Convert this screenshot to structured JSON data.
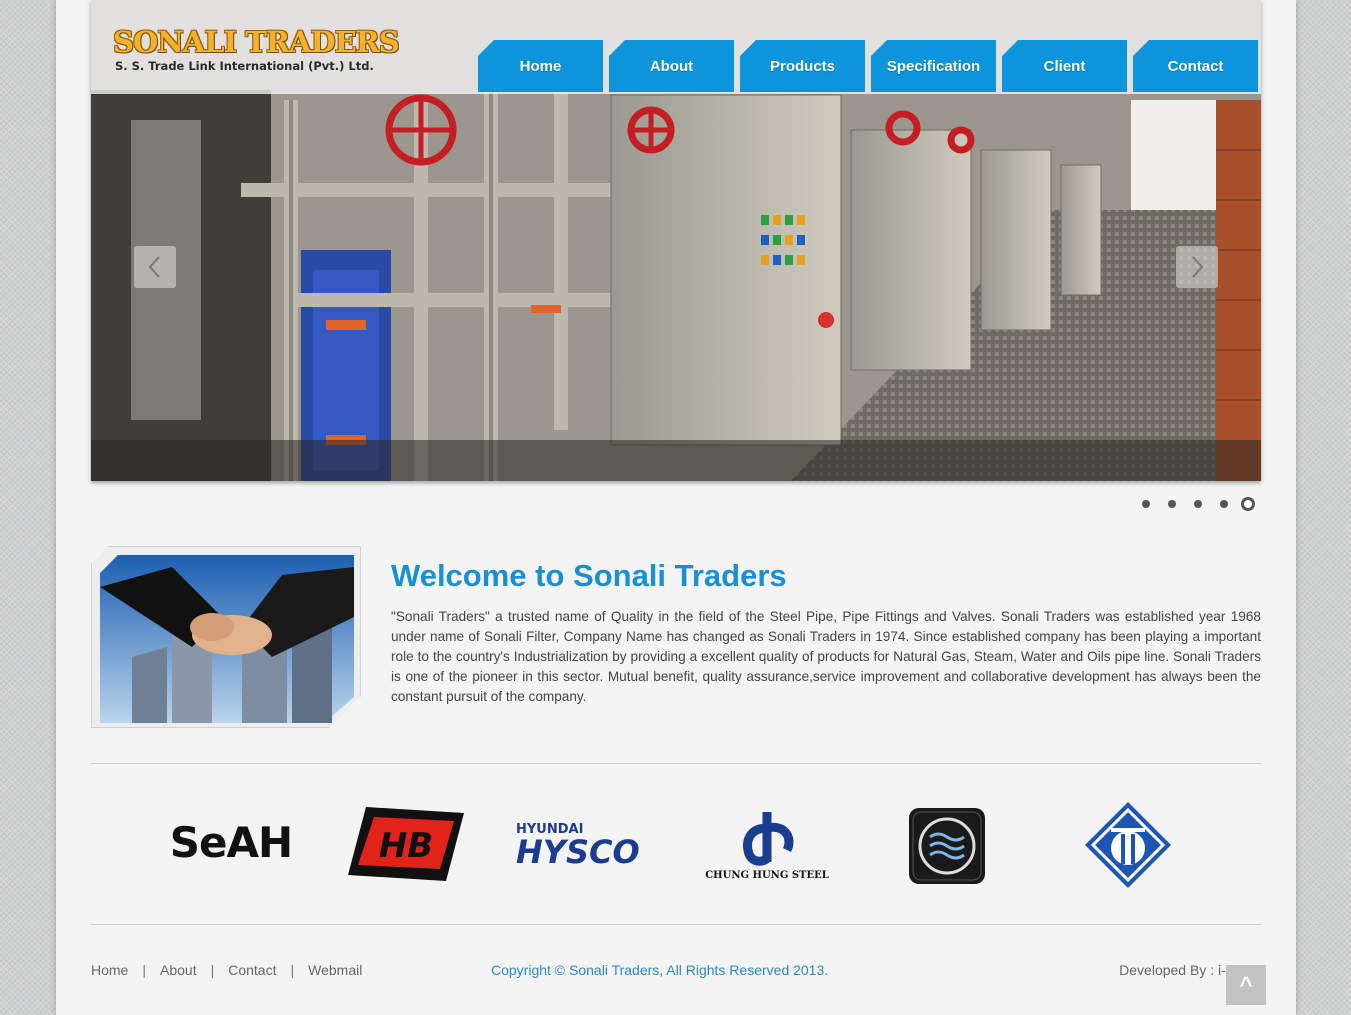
{
  "logo": {
    "title": "SONALI TRADERS",
    "subtitle": "S. S. Trade Link International (Pvt.) Ltd."
  },
  "nav": {
    "items": [
      {
        "label": "Home"
      },
      {
        "label": "About"
      },
      {
        "label": "Products"
      },
      {
        "label": "Specification"
      },
      {
        "label": "Client"
      },
      {
        "label": "Contact"
      }
    ]
  },
  "slider": {
    "slide_count": 5,
    "active_index": 4,
    "prev_icon": "chevron-left-icon",
    "next_icon": "chevron-right-icon"
  },
  "welcome": {
    "title": "Welcome to Sonali Traders",
    "text": "\"Sonali Traders\" a trusted name of Quality in the field of the Steel Pipe, Pipe Fittings and Valves. Sonali Traders was established year 1968 under name of Sonali Filter, Company Name has changed as Sonali Traders in 1974. Since established company has been playing a important role to the country's Industrialization by providing a excellent quality of products for Natural Gas, Steam, Water and Oils pipe line. Sonali Traders is one of the pioneer in this sector. Mutual benefit, quality assurance,service improvement and collaborative development has always been the constant pursuit of the company."
  },
  "clients": {
    "seah": "SeAH",
    "hb": "HB",
    "hysco_top": "HYUNDAI",
    "hysco_main": "HYSCO",
    "chung_hung": "CHUNG HUNG STEEL"
  },
  "footer": {
    "links": [
      "Home",
      "About",
      "Contact",
      "Webmail"
    ],
    "copyright": "Copyright © Sonali Traders, All Rights Reserved 2013.",
    "developer": "Developed By : i-Mesh",
    "back_to_top": "^"
  },
  "colors": {
    "accent": "#0d95dc",
    "title": "#1990d3",
    "logo": "#f2b22a"
  }
}
